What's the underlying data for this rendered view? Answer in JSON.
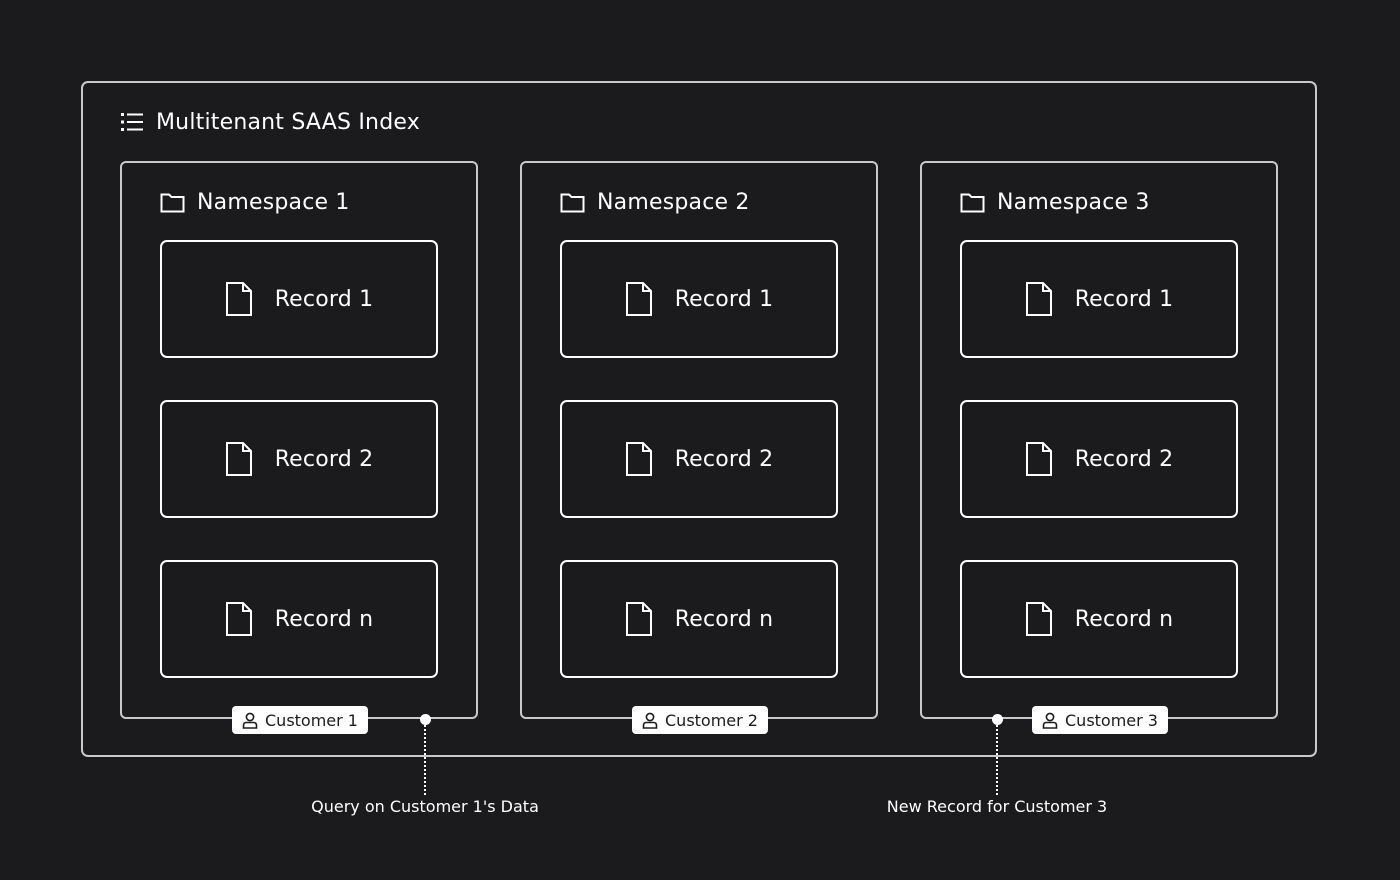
{
  "index": {
    "title": "Multitenant SAAS Index",
    "icon": "list-icon"
  },
  "namespaces": [
    {
      "title": "Namespace 1",
      "records": [
        "Record 1",
        "Record 2",
        "Record n"
      ],
      "customer": "Customer 1"
    },
    {
      "title": "Namespace 2",
      "records": [
        "Record 1",
        "Record 2",
        "Record n"
      ],
      "customer": "Customer 2"
    },
    {
      "title": "Namespace 3",
      "records": [
        "Record 1",
        "Record 2",
        "Record n"
      ],
      "customer": "Customer 3"
    }
  ],
  "annotations": {
    "query": "Query on Customer 1's Data",
    "new_record": "New Record for Customer 3"
  },
  "colors": {
    "background": "#1b1b1d",
    "border": "#c9c9cb",
    "foreground": "#ffffff"
  }
}
